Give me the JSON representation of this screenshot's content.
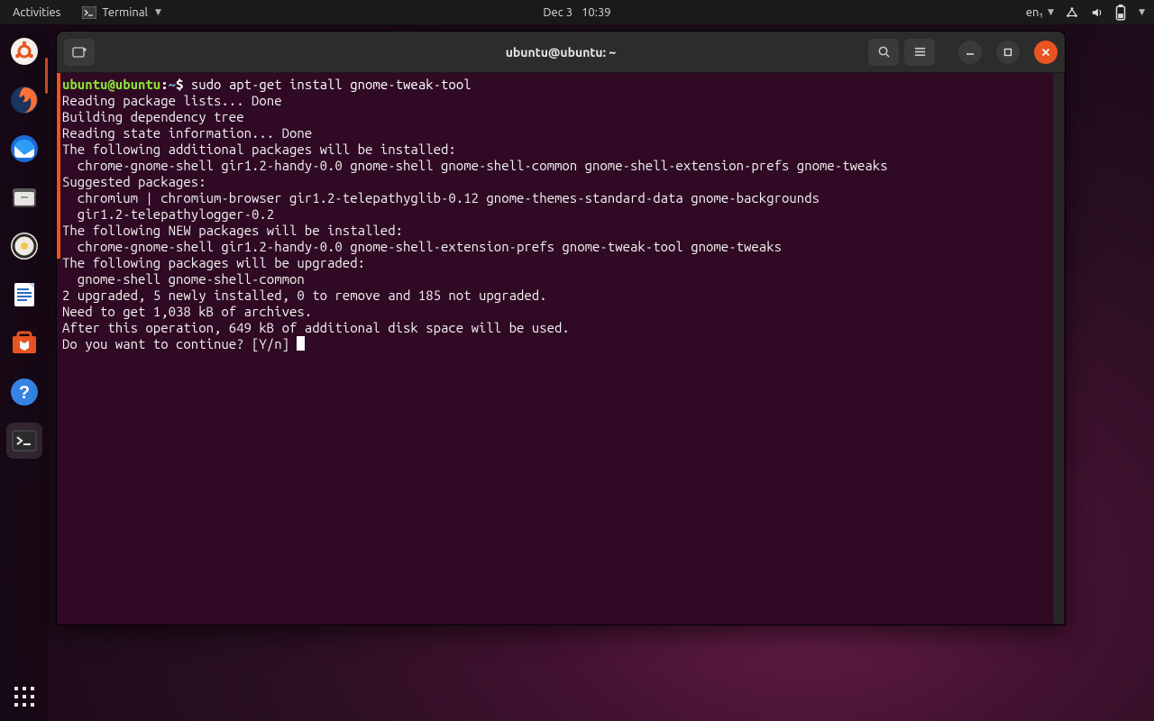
{
  "panel": {
    "activities": "Activities",
    "app_name": "Terminal",
    "date": "Dec 3",
    "time": "10:39",
    "lang": "en₁"
  },
  "dock": {
    "items": [
      {
        "name": "ubuntu-software-updater"
      },
      {
        "name": "firefox"
      },
      {
        "name": "thunderbird"
      },
      {
        "name": "files"
      },
      {
        "name": "rhythmbox"
      },
      {
        "name": "libreoffice-writer"
      },
      {
        "name": "ubuntu-software"
      },
      {
        "name": "help"
      },
      {
        "name": "terminal"
      }
    ]
  },
  "window": {
    "title": "ubuntu@ubuntu: ~"
  },
  "terminal": {
    "prompt_user": "ubuntu@ubuntu",
    "prompt_sep": ":",
    "prompt_path": "~",
    "prompt_dollar": "$",
    "command": "sudo apt-get install gnome-tweak-tool",
    "lines": [
      "Reading package lists... Done",
      "Building dependency tree",
      "Reading state information... Done",
      "The following additional packages will be installed:",
      "  chrome-gnome-shell gir1.2-handy-0.0 gnome-shell gnome-shell-common gnome-shell-extension-prefs gnome-tweaks",
      "Suggested packages:",
      "  chromium | chromium-browser gir1.2-telepathyglib-0.12 gnome-themes-standard-data gnome-backgrounds",
      "  gir1.2-telepathylogger-0.2",
      "The following NEW packages will be installed:",
      "  chrome-gnome-shell gir1.2-handy-0.0 gnome-shell-extension-prefs gnome-tweak-tool gnome-tweaks",
      "The following packages will be upgraded:",
      "  gnome-shell gnome-shell-common",
      "2 upgraded, 5 newly installed, 0 to remove and 185 not upgraded.",
      "Need to get 1,038 kB of archives.",
      "After this operation, 649 kB of additional disk space will be used.",
      "Do you want to continue? [Y/n] "
    ]
  }
}
